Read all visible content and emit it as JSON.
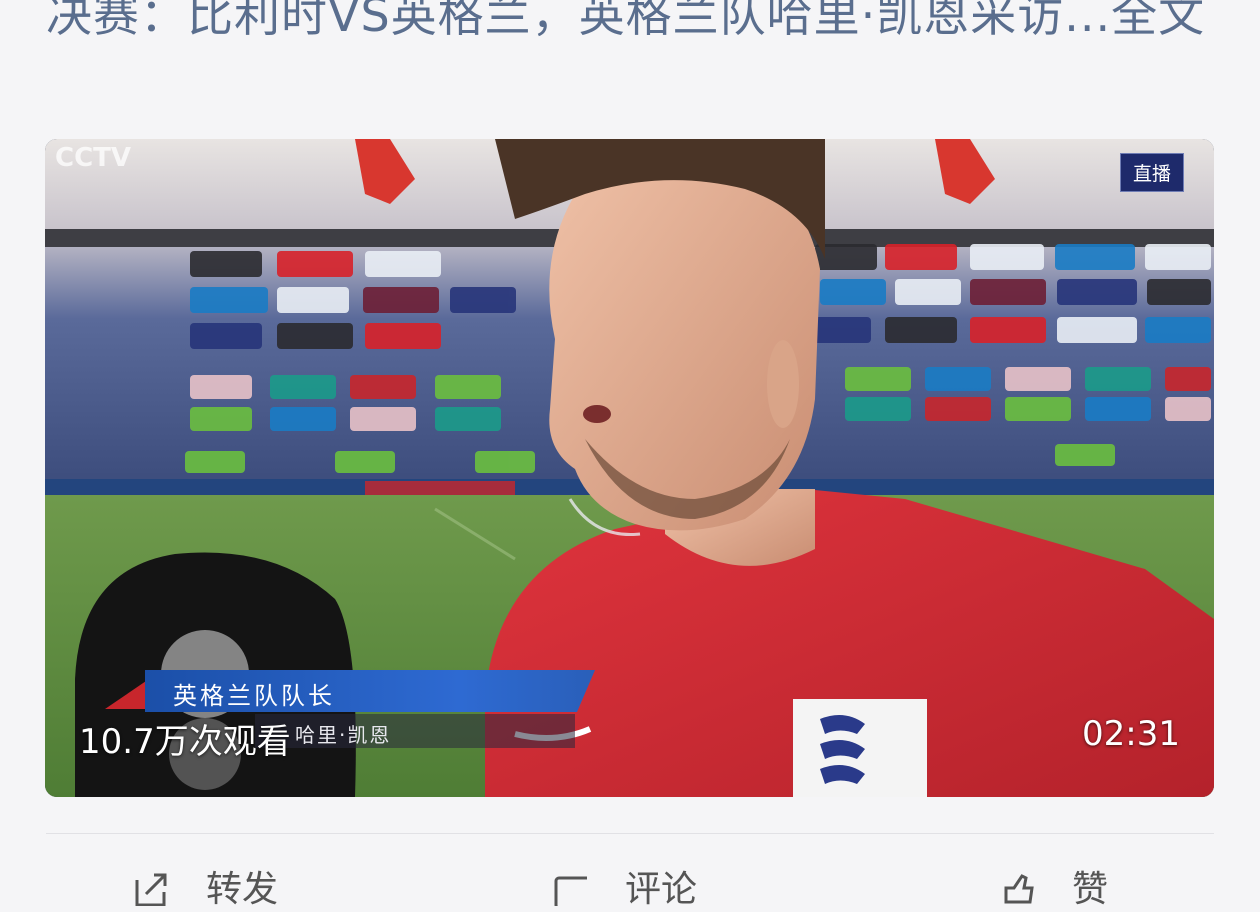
{
  "article": {
    "title": "决赛：比利时VS英格兰，英格兰队哈里·凯恩采访...全文"
  },
  "video": {
    "channel_logo": "CCTV",
    "live_badge": "直播",
    "caption_title": "英格兰队队长",
    "caption_name": "哈里·凯恩",
    "views": "10.7万次观看",
    "duration": "02:31"
  },
  "actions": [
    {
      "label": "转发",
      "icon": "share-icon"
    },
    {
      "label": "评论",
      "icon": "comment-icon"
    },
    {
      "label": "赞",
      "icon": "like-icon"
    }
  ],
  "colors": {
    "title_text": "#5a6e8e",
    "background": "#f5f5f7",
    "caption_blue": "#2e6ad2",
    "jersey_red": "#d42b34"
  }
}
